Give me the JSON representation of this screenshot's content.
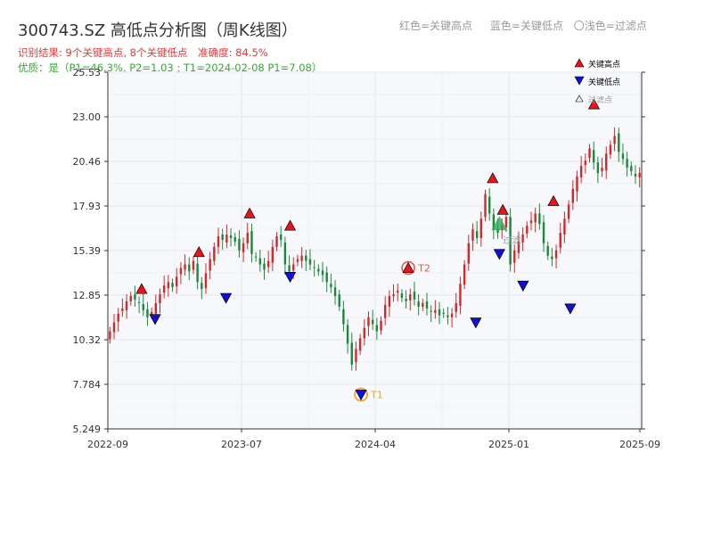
{
  "header": {
    "title": "300743.SZ 高低点分析图（周K线图）",
    "result_text": "识别结果: 9个关键高点, 8个关键低点",
    "accuracy_text": "准确度: 84.5%",
    "quality_text": "优质：是（P1=46.3%, P2=1.03 ; T1=2024-02-08 P1=7.08）"
  },
  "legend_top": {
    "red": "红色=关键高点",
    "blue": "蓝色=关键低点",
    "light": "〇浅色=过滤点"
  },
  "legend_box": {
    "high": "关键高点",
    "low": "关键低点",
    "filtered": "过滤点"
  },
  "colors": {
    "up": "#d62728",
    "down": "#1a8a3a",
    "high_marker": "#e8141c",
    "low_marker": "#1010d8",
    "t1": "#f5a623",
    "t2": "#e45a4a",
    "filtered": "#2eaa55"
  },
  "chart_data": {
    "type": "candlestick",
    "title": "300743.SZ 高低点分析图（周K线图）",
    "period": "weekly",
    "x_ticks": [
      "2022-09",
      "2023-07",
      "2024-04",
      "2025-01",
      "2025-09"
    ],
    "y_ticks": [
      "5.249",
      "7.784",
      "10.32",
      "12.85",
      "15.39",
      "17.93",
      "20.46",
      "23.00",
      "25.53"
    ],
    "ylim": [
      5.249,
      25.53
    ],
    "x_range": [
      "2022-09-01",
      "2025-09-12"
    ],
    "key_highs": [
      {
        "date": "2022-11-10",
        "price": 13.2
      },
      {
        "date": "2023-03-09",
        "price": 15.3
      },
      {
        "date": "2023-06-22",
        "price": 17.5
      },
      {
        "date": "2023-09-14",
        "price": 16.8
      },
      {
        "date": "2024-05-16",
        "price": 14.4,
        "label": "T2"
      },
      {
        "date": "2024-11-07",
        "price": 19.5
      },
      {
        "date": "2024-11-28",
        "price": 17.7
      },
      {
        "date": "2025-03-13",
        "price": 18.2
      },
      {
        "date": "2025-06-05",
        "price": 23.7
      }
    ],
    "key_lows": [
      {
        "date": "2022-12-08",
        "price": 11.5
      },
      {
        "date": "2023-05-04",
        "price": 12.7
      },
      {
        "date": "2023-09-14",
        "price": 13.9
      },
      {
        "date": "2024-02-08",
        "price": 7.2,
        "label": "T1"
      },
      {
        "date": "2024-10-03",
        "price": 11.3
      },
      {
        "date": "2024-11-21",
        "price": 15.2
      },
      {
        "date": "2025-01-09",
        "price": 13.4
      },
      {
        "date": "2025-04-17",
        "price": 12.1
      }
    ],
    "filtered_points": [
      {
        "date": "2024-11-21",
        "price": 16.9,
        "label": "过滤"
      }
    ],
    "weekly_close": [
      10.8,
      11.3,
      11.8,
      12.1,
      12.5,
      12.8,
      12.6,
      12.4,
      12.0,
      11.6,
      11.9,
      12.4,
      12.9,
      13.4,
      13.6,
      13.3,
      13.9,
      14.4,
      14.6,
      14.2,
      14.8,
      13.6,
      13.2,
      14.1,
      14.9,
      15.6,
      16.2,
      16.0,
      16.3,
      16.1,
      15.9,
      15.4,
      15.8,
      16.4,
      15.2,
      15.0,
      14.6,
      14.3,
      14.8,
      15.6,
      16.2,
      16.0,
      14.6,
      14.2,
      14.6,
      14.9,
      15.1,
      14.8,
      14.6,
      14.4,
      14.2,
      14.0,
      13.6,
      13.3,
      12.8,
      12.2,
      11.2,
      10.1,
      8.9,
      9.8,
      10.4,
      11.0,
      11.6,
      11.2,
      10.8,
      11.4,
      12.3,
      12.8,
      12.9,
      13.1,
      12.7,
      12.5,
      12.9,
      12.6,
      12.2,
      12.4,
      12.1,
      11.9,
      12.0,
      11.7,
      11.8,
      11.6,
      11.8,
      12.4,
      13.5,
      14.6,
      15.8,
      16.6,
      16.1,
      17.2,
      18.6,
      17.5,
      16.6,
      16.4,
      16.8,
      17.3,
      14.6,
      15.4,
      15.9,
      16.3,
      16.8,
      17.1,
      17.5,
      16.9,
      15.8,
      15.1,
      14.9,
      15.4,
      16.4,
      17.2,
      18.0,
      18.9,
      19.6,
      20.2,
      20.5,
      21.2,
      20.4,
      19.8,
      20.1,
      20.9,
      21.4,
      21.9,
      21.0,
      20.6,
      20.1,
      19.9,
      19.6,
      19.8
    ]
  }
}
